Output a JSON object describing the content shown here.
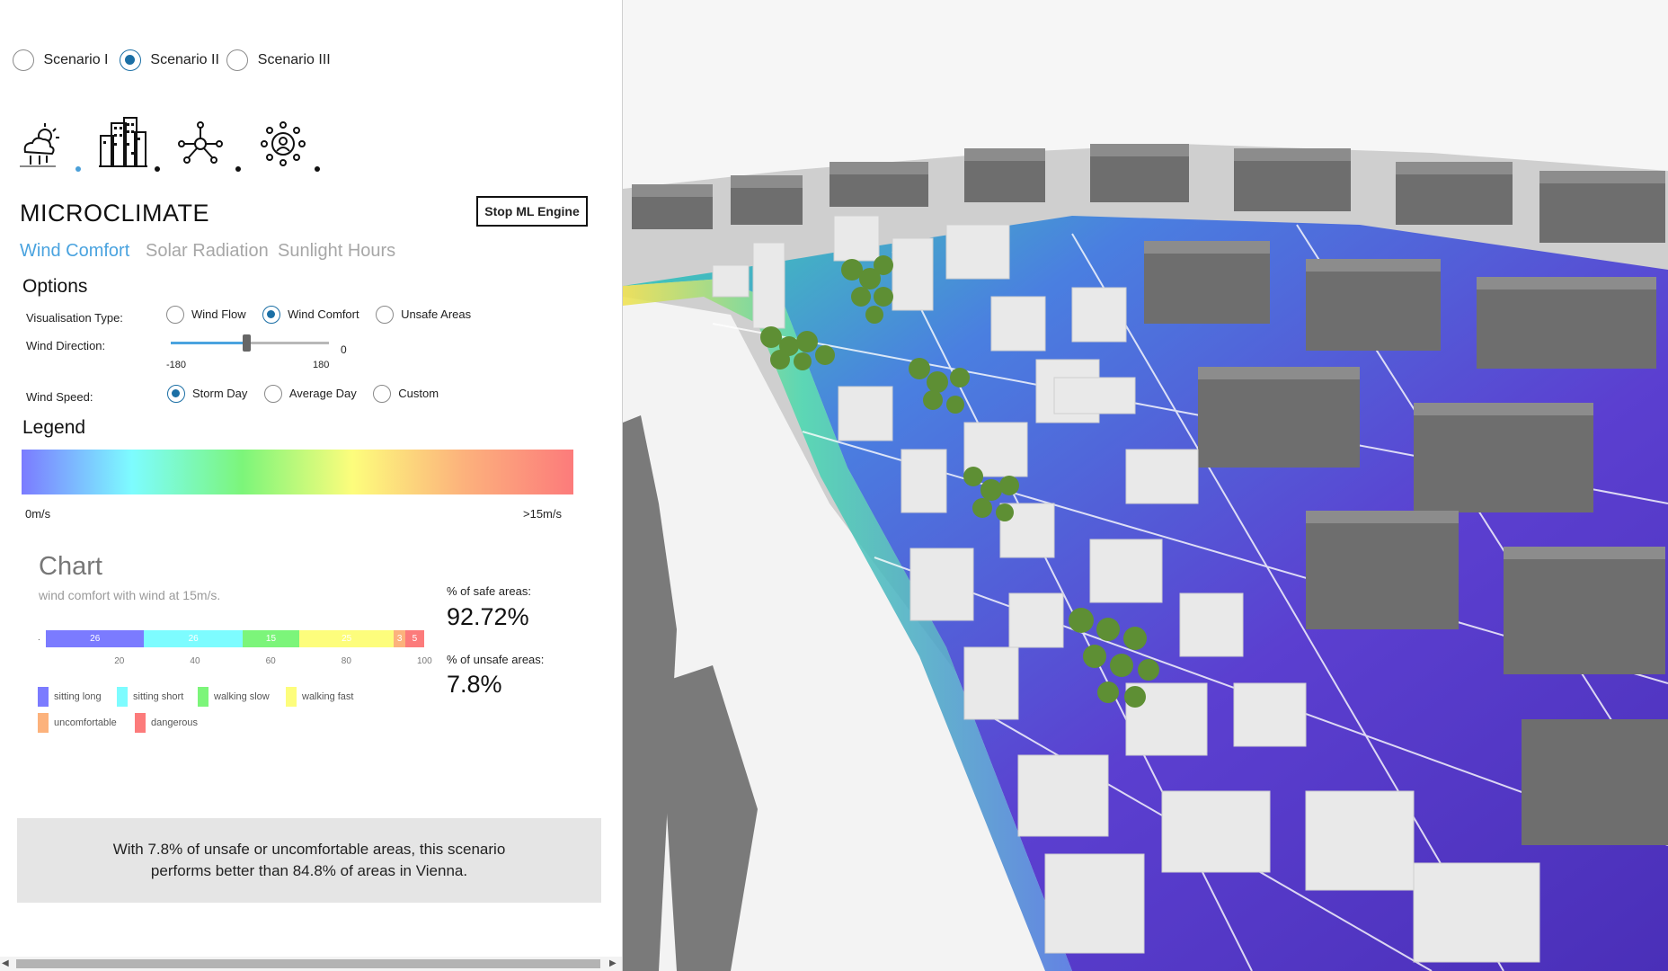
{
  "scenarios": [
    {
      "label": "Scenario I",
      "selected": false
    },
    {
      "label": "Scenario II",
      "selected": true
    },
    {
      "label": "Scenario III",
      "selected": false
    }
  ],
  "category_icons": [
    {
      "name": "microclimate-icon",
      "active": true
    },
    {
      "name": "buildings-icon",
      "active": false
    },
    {
      "name": "network-icon",
      "active": false
    },
    {
      "name": "community-icon",
      "active": false
    }
  ],
  "section_title": "MICROCLIMATE",
  "stop_button_label": "Stop ML Engine",
  "tabs": [
    {
      "label": "Wind Comfort",
      "active": true
    },
    {
      "label": "Solar Radiation",
      "active": false
    },
    {
      "label": "Sunlight Hours",
      "active": false
    }
  ],
  "options": {
    "title": "Options",
    "visualisation_label": "Visualisation Type:",
    "visualisation_options": [
      {
        "label": "Wind Flow",
        "selected": false
      },
      {
        "label": "Wind Comfort",
        "selected": true
      },
      {
        "label": "Unsafe Areas",
        "selected": false
      }
    ],
    "wind_direction_label": "Wind Direction:",
    "slider_value": "0",
    "slider_min": "-180",
    "slider_max": "180",
    "slider_fraction": 0.48,
    "wind_speed_label": "Wind Speed:",
    "wind_speed_options": [
      {
        "label": "Storm Day",
        "selected": true
      },
      {
        "label": "Average Day",
        "selected": false
      },
      {
        "label": "Custom",
        "selected": false
      }
    ]
  },
  "legend": {
    "title": "Legend",
    "min_label": "0m/s",
    "max_label": ">15m/s",
    "colors": [
      "#7b7bff",
      "#7dfcff",
      "#7cf57a",
      "#fdfd7c",
      "#fcb27c",
      "#fc7b7b"
    ]
  },
  "chart": {
    "title": "Chart",
    "subtitle": "wind comfort with wind at 15m/s.",
    "safe_label": "% of safe areas:",
    "safe_value": "92.72%",
    "unsafe_label": "% of unsafe areas:",
    "unsafe_value": "7.8%",
    "axis_start_label": ".",
    "axis_ticks": [
      "20",
      "40",
      "60",
      "80",
      "100"
    ],
    "legend_items": [
      "sitting long",
      "sitting short",
      "walking slow",
      "walking fast",
      "uncomfortable",
      "dangerous"
    ]
  },
  "chart_data": {
    "type": "bar",
    "orientation": "horizontal-stacked",
    "title": "Chart",
    "subtitle": "wind comfort with wind at 15m/s.",
    "xlim": [
      0,
      100
    ],
    "x_ticks": [
      20,
      40,
      60,
      80,
      100
    ],
    "series": [
      {
        "name": "sitting long",
        "value": 26,
        "label": "26",
        "color": "#7b7bff"
      },
      {
        "name": "sitting short",
        "value": 26,
        "label": "26",
        "color": "#7dfcff"
      },
      {
        "name": "walking slow",
        "value": 15,
        "label": "15",
        "color": "#7cf57a"
      },
      {
        "name": "walking fast",
        "value": 25,
        "label": "25",
        "color": "#fdfd7c"
      },
      {
        "name": "uncomfortable",
        "value": 3,
        "label": "3",
        "color": "#fcb27c"
      },
      {
        "name": "dangerous",
        "value": 5,
        "label": "5",
        "color": "#fc7b7b"
      }
    ]
  },
  "summary_text": "With 7.8% of unsafe or uncomfortable areas, this scenario performs better than 84.8% of areas in Vienna."
}
